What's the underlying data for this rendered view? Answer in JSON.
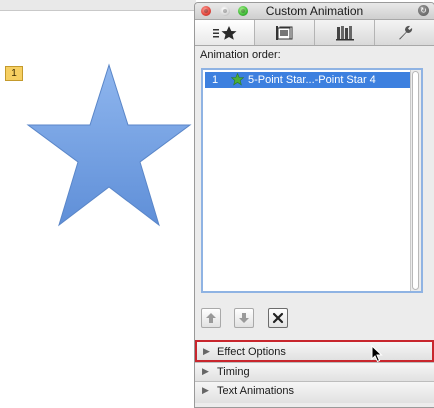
{
  "slide": {
    "animation_tag": "1"
  },
  "palette": {
    "title": "Custom Animation",
    "tabs": [
      {
        "icon": "star-effects-icon",
        "active": true
      },
      {
        "icon": "transitions-icon",
        "active": false
      },
      {
        "icon": "library-icon",
        "active": false
      },
      {
        "icon": "wrench-icon",
        "active": false
      }
    ],
    "order_label": "Animation order:",
    "animations": [
      {
        "number": "1",
        "name": "5-Point Star...-Point Star 4",
        "icon": "entrance-star-icon",
        "selected": true
      }
    ],
    "sections": {
      "effect_options": "Effect Options",
      "timing": "Timing",
      "text_animations": "Text Animations"
    }
  },
  "colors": {
    "selection": "#3d80df",
    "highlight_box": "#c8262d",
    "star_fill": "#7ba6e6",
    "tag_fill": "#f6cf62"
  }
}
